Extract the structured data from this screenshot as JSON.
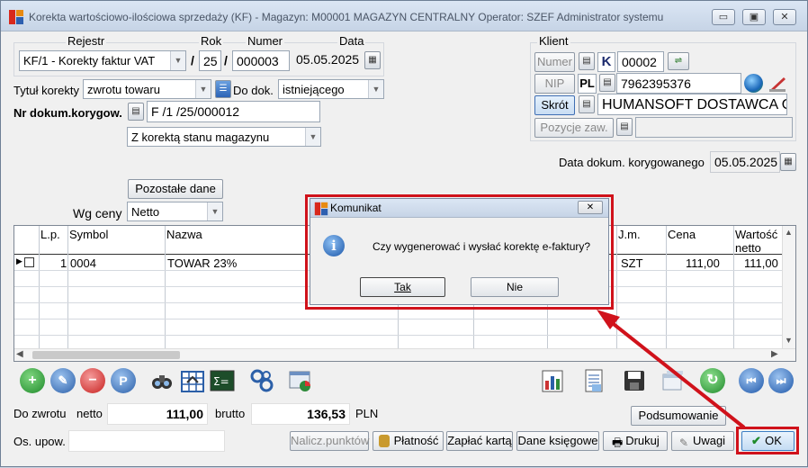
{
  "window": {
    "title": "Korekta wartościowo-ilościowa sprzedaży (KF) - Magazyn: M00001 MAGAZYN CENTRALNY  Operator: SZEF Administrator systemu",
    "btn_minimize": "▭",
    "btn_restore": "▣",
    "btn_close": "✕"
  },
  "header": {
    "rejestr_label": "Rejestr",
    "rejestr_value": "KF/1   - Korekty faktur VAT",
    "rok_label": "Rok",
    "rok_value": "25",
    "numer_label": "Numer",
    "numer_value": "000003",
    "data_label": "Data",
    "data_value": "05.05.2025",
    "slash": "/",
    "tytul_label": "Tytuł korekty",
    "tytul_value": "zwrotu towaru",
    "do_dok_label": "Do dok.",
    "do_dok_value": "istniejącego",
    "nr_dok_label": "Nr dokum.korygow.",
    "nr_dok_value": "F /1  /25/000012",
    "stan_value": "Z korektą stanu magazynu",
    "pozostale_button": "Pozostałe dane",
    "wg_ceny_label": "Wg ceny",
    "wg_ceny_value": "Netto"
  },
  "klient": {
    "label": "Klient",
    "numer_button": "Numer",
    "k_badge": "K",
    "numer_value": "00002",
    "nip_button": "NIP",
    "pl_badge": "PL",
    "nip_value": "7962395376",
    "skrot_button": "Skrót",
    "skrot_value": "HUMANSOFT DOSTAWCA OD",
    "pozycje_button": "Pozycje zaw.",
    "pozycje_value": ""
  },
  "data_korygowanego": {
    "label": "Data dokum. korygowanego",
    "value": "05.05.2025"
  },
  "grid": {
    "columns": [
      "L.p.",
      "Symbol",
      "Nazwa",
      "J.m.",
      "Cena",
      "Wartość",
      "netto"
    ],
    "rows": [
      {
        "lp": "1",
        "symbol": "0004",
        "nazwa": "TOWAR 23%",
        "jm": "SZT",
        "cena": "111,00",
        "wartosc": "111,00"
      }
    ]
  },
  "totals": {
    "do_zwrotu_label": "Do zwrotu",
    "netto_label": "netto",
    "netto_value": "111,00",
    "brutto_label": "brutto",
    "brutto_value": "136,53",
    "currency": "PLN",
    "os_upow_label": "Os. upow.",
    "os_upow_value": ""
  },
  "bottom_buttons": {
    "podsumowanie": "Podsumowanie",
    "nalicz": "Nalicz.punktów",
    "platnosc": "Płatność",
    "zaplac": "Zapłać kartą",
    "dane_ksiegowe": "Dane księgowe",
    "drukuj": "Drukuj",
    "uwagi": "Uwagi",
    "ok": "OK"
  },
  "dialog": {
    "title": "Komunikat",
    "message": "Czy wygenerować i wysłać korektę e-faktury?",
    "yes": "Tak",
    "no": "Nie",
    "close": "✕"
  },
  "colors": {
    "highlight": "#d0121b",
    "title_bg": "#c6d4e6"
  }
}
